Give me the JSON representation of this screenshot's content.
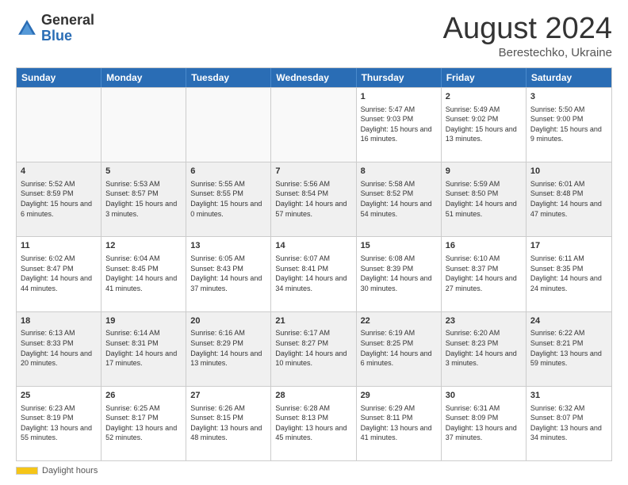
{
  "logo": {
    "general": "General",
    "blue": "Blue"
  },
  "title": {
    "month_year": "August 2024",
    "location": "Berestechko, Ukraine"
  },
  "days_of_week": [
    "Sunday",
    "Monday",
    "Tuesday",
    "Wednesday",
    "Thursday",
    "Friday",
    "Saturday"
  ],
  "weeks": [
    [
      {
        "day": "",
        "sunrise": "",
        "sunset": "",
        "daylight": "",
        "empty": true
      },
      {
        "day": "",
        "sunrise": "",
        "sunset": "",
        "daylight": "",
        "empty": true
      },
      {
        "day": "",
        "sunrise": "",
        "sunset": "",
        "daylight": "",
        "empty": true
      },
      {
        "day": "",
        "sunrise": "",
        "sunset": "",
        "daylight": "",
        "empty": true
      },
      {
        "day": "1",
        "sunrise": "Sunrise: 5:47 AM",
        "sunset": "Sunset: 9:03 PM",
        "daylight": "Daylight: 15 hours and 16 minutes.",
        "empty": false
      },
      {
        "day": "2",
        "sunrise": "Sunrise: 5:49 AM",
        "sunset": "Sunset: 9:02 PM",
        "daylight": "Daylight: 15 hours and 13 minutes.",
        "empty": false
      },
      {
        "day": "3",
        "sunrise": "Sunrise: 5:50 AM",
        "sunset": "Sunset: 9:00 PM",
        "daylight": "Daylight: 15 hours and 9 minutes.",
        "empty": false
      }
    ],
    [
      {
        "day": "4",
        "sunrise": "Sunrise: 5:52 AM",
        "sunset": "Sunset: 8:59 PM",
        "daylight": "Daylight: 15 hours and 6 minutes.",
        "empty": false
      },
      {
        "day": "5",
        "sunrise": "Sunrise: 5:53 AM",
        "sunset": "Sunset: 8:57 PM",
        "daylight": "Daylight: 15 hours and 3 minutes.",
        "empty": false
      },
      {
        "day": "6",
        "sunrise": "Sunrise: 5:55 AM",
        "sunset": "Sunset: 8:55 PM",
        "daylight": "Daylight: 15 hours and 0 minutes.",
        "empty": false
      },
      {
        "day": "7",
        "sunrise": "Sunrise: 5:56 AM",
        "sunset": "Sunset: 8:54 PM",
        "daylight": "Daylight: 14 hours and 57 minutes.",
        "empty": false
      },
      {
        "day": "8",
        "sunrise": "Sunrise: 5:58 AM",
        "sunset": "Sunset: 8:52 PM",
        "daylight": "Daylight: 14 hours and 54 minutes.",
        "empty": false
      },
      {
        "day": "9",
        "sunrise": "Sunrise: 5:59 AM",
        "sunset": "Sunset: 8:50 PM",
        "daylight": "Daylight: 14 hours and 51 minutes.",
        "empty": false
      },
      {
        "day": "10",
        "sunrise": "Sunrise: 6:01 AM",
        "sunset": "Sunset: 8:48 PM",
        "daylight": "Daylight: 14 hours and 47 minutes.",
        "empty": false
      }
    ],
    [
      {
        "day": "11",
        "sunrise": "Sunrise: 6:02 AM",
        "sunset": "Sunset: 8:47 PM",
        "daylight": "Daylight: 14 hours and 44 minutes.",
        "empty": false
      },
      {
        "day": "12",
        "sunrise": "Sunrise: 6:04 AM",
        "sunset": "Sunset: 8:45 PM",
        "daylight": "Daylight: 14 hours and 41 minutes.",
        "empty": false
      },
      {
        "day": "13",
        "sunrise": "Sunrise: 6:05 AM",
        "sunset": "Sunset: 8:43 PM",
        "daylight": "Daylight: 14 hours and 37 minutes.",
        "empty": false
      },
      {
        "day": "14",
        "sunrise": "Sunrise: 6:07 AM",
        "sunset": "Sunset: 8:41 PM",
        "daylight": "Daylight: 14 hours and 34 minutes.",
        "empty": false
      },
      {
        "day": "15",
        "sunrise": "Sunrise: 6:08 AM",
        "sunset": "Sunset: 8:39 PM",
        "daylight": "Daylight: 14 hours and 30 minutes.",
        "empty": false
      },
      {
        "day": "16",
        "sunrise": "Sunrise: 6:10 AM",
        "sunset": "Sunset: 8:37 PM",
        "daylight": "Daylight: 14 hours and 27 minutes.",
        "empty": false
      },
      {
        "day": "17",
        "sunrise": "Sunrise: 6:11 AM",
        "sunset": "Sunset: 8:35 PM",
        "daylight": "Daylight: 14 hours and 24 minutes.",
        "empty": false
      }
    ],
    [
      {
        "day": "18",
        "sunrise": "Sunrise: 6:13 AM",
        "sunset": "Sunset: 8:33 PM",
        "daylight": "Daylight: 14 hours and 20 minutes.",
        "empty": false
      },
      {
        "day": "19",
        "sunrise": "Sunrise: 6:14 AM",
        "sunset": "Sunset: 8:31 PM",
        "daylight": "Daylight: 14 hours and 17 minutes.",
        "empty": false
      },
      {
        "day": "20",
        "sunrise": "Sunrise: 6:16 AM",
        "sunset": "Sunset: 8:29 PM",
        "daylight": "Daylight: 14 hours and 13 minutes.",
        "empty": false
      },
      {
        "day": "21",
        "sunrise": "Sunrise: 6:17 AM",
        "sunset": "Sunset: 8:27 PM",
        "daylight": "Daylight: 14 hours and 10 minutes.",
        "empty": false
      },
      {
        "day": "22",
        "sunrise": "Sunrise: 6:19 AM",
        "sunset": "Sunset: 8:25 PM",
        "daylight": "Daylight: 14 hours and 6 minutes.",
        "empty": false
      },
      {
        "day": "23",
        "sunrise": "Sunrise: 6:20 AM",
        "sunset": "Sunset: 8:23 PM",
        "daylight": "Daylight: 14 hours and 3 minutes.",
        "empty": false
      },
      {
        "day": "24",
        "sunrise": "Sunrise: 6:22 AM",
        "sunset": "Sunset: 8:21 PM",
        "daylight": "Daylight: 13 hours and 59 minutes.",
        "empty": false
      }
    ],
    [
      {
        "day": "25",
        "sunrise": "Sunrise: 6:23 AM",
        "sunset": "Sunset: 8:19 PM",
        "daylight": "Daylight: 13 hours and 55 minutes.",
        "empty": false
      },
      {
        "day": "26",
        "sunrise": "Sunrise: 6:25 AM",
        "sunset": "Sunset: 8:17 PM",
        "daylight": "Daylight: 13 hours and 52 minutes.",
        "empty": false
      },
      {
        "day": "27",
        "sunrise": "Sunrise: 6:26 AM",
        "sunset": "Sunset: 8:15 PM",
        "daylight": "Daylight: 13 hours and 48 minutes.",
        "empty": false
      },
      {
        "day": "28",
        "sunrise": "Sunrise: 6:28 AM",
        "sunset": "Sunset: 8:13 PM",
        "daylight": "Daylight: 13 hours and 45 minutes.",
        "empty": false
      },
      {
        "day": "29",
        "sunrise": "Sunrise: 6:29 AM",
        "sunset": "Sunset: 8:11 PM",
        "daylight": "Daylight: 13 hours and 41 minutes.",
        "empty": false
      },
      {
        "day": "30",
        "sunrise": "Sunrise: 6:31 AM",
        "sunset": "Sunset: 8:09 PM",
        "daylight": "Daylight: 13 hours and 37 minutes.",
        "empty": false
      },
      {
        "day": "31",
        "sunrise": "Sunrise: 6:32 AM",
        "sunset": "Sunset: 8:07 PM",
        "daylight": "Daylight: 13 hours and 34 minutes.",
        "empty": false
      }
    ]
  ],
  "footer": {
    "legend_label": "Daylight hours"
  }
}
